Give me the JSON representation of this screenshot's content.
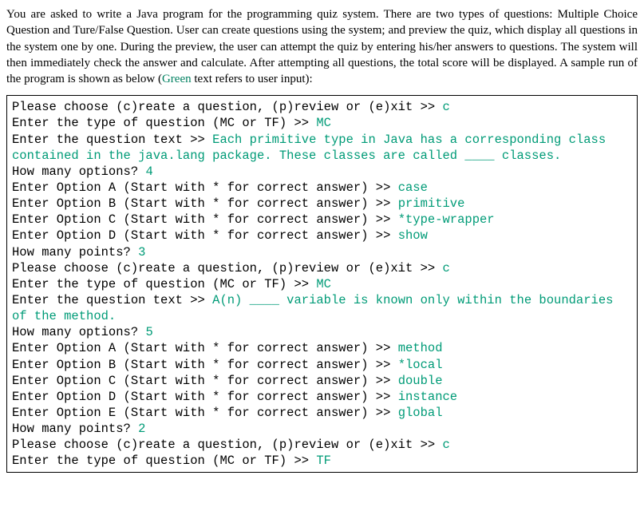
{
  "instructions": {
    "text": "You are asked to write a Java program for the programming quiz system. There are two types of questions: Multiple Choice Question and Ture/False Question. User can create questions using the system; and preview the quiz, which display all questions in the system one by one. During the preview, the user can attempt the quiz by entering his/her answers to questions. The system will then immediately check the answer and calculate. After attempting all questions, the total score will be displayed. A sample run of the program is shown as below (",
    "green_word": "Green",
    "text_suffix": " text refers to user input):"
  },
  "lines": [
    {
      "p": "Please choose (c)reate a question, (p)review or (e)xit >> ",
      "u": "c"
    },
    {
      "p": "Enter the type of question (MC or TF) >> ",
      "u": "MC"
    },
    {
      "p": "Enter the question text >> ",
      "u": "Each primitive type in Java has a corresponding class contained in the java.lang package. These classes are called ____ classes."
    },
    {
      "p": "How many options? ",
      "u": "4"
    },
    {
      "p": "Enter Option A (Start with * for correct answer) >> ",
      "u": "case"
    },
    {
      "p": "Enter Option B (Start with * for correct answer) >> ",
      "u": "primitive"
    },
    {
      "p": "Enter Option C (Start with * for correct answer) >> ",
      "u": "*type-wrapper"
    },
    {
      "p": "Enter Option D (Start with * for correct answer) >> ",
      "u": "show"
    },
    {
      "p": "How many points? ",
      "u": "3"
    },
    {
      "p": "Please choose (c)reate a question, (p)review or (e)xit >> ",
      "u": "c"
    },
    {
      "p": "Enter the type of question (MC or TF) >> ",
      "u": "MC"
    },
    {
      "p": "Enter the question text >> ",
      "u": "A(n) ____ variable is known only within the boundaries of the method."
    },
    {
      "p": "How many options? ",
      "u": "5"
    },
    {
      "p": "Enter Option A (Start with * for correct answer) >> ",
      "u": "method"
    },
    {
      "p": "Enter Option B (Start with * for correct answer) >> ",
      "u": "*local"
    },
    {
      "p": "Enter Option C (Start with * for correct answer) >> ",
      "u": "double"
    },
    {
      "p": "Enter Option D (Start with * for correct answer) >> ",
      "u": "instance"
    },
    {
      "p": "Enter Option E (Start with * for correct answer) >> ",
      "u": "global"
    },
    {
      "p": "How many points? ",
      "u": "2"
    },
    {
      "p": "Please choose (c)reate a question, (p)review or (e)xit >> ",
      "u": "c"
    },
    {
      "p": "Enter the type of question (MC or TF) >> ",
      "u": "TF"
    }
  ]
}
